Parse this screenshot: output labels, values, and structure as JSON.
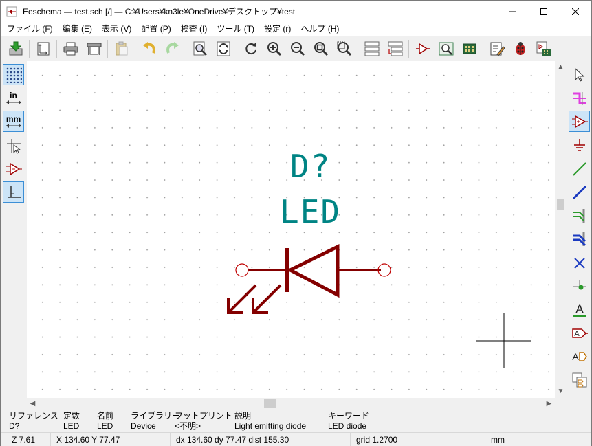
{
  "window": {
    "title": "Eeschema — test.sch [/] — C:¥Users¥kn3le¥OneDrive¥デスクトップ¥test"
  },
  "menu": [
    {
      "label": "ファイル (F)"
    },
    {
      "label": "編集 (E)"
    },
    {
      "label": "表示 (V)"
    },
    {
      "label": "配置 (P)"
    },
    {
      "label": "検査 (I)"
    },
    {
      "label": "ツール (T)"
    },
    {
      "label": "設定 (r)"
    },
    {
      "label": "ヘルプ (H)"
    }
  ],
  "left_toolbar": {
    "units_in_label": "in",
    "units_mm_label": "mm"
  },
  "schematic": {
    "reference": "D?",
    "value": "LED",
    "colors": {
      "wire_body": "#840000",
      "text": "#008484",
      "pin_end": "#c00000"
    }
  },
  "message_panel": [
    {
      "header": "リファレンス",
      "value": "D?"
    },
    {
      "header": "定数",
      "value": "LED"
    },
    {
      "header": "名前",
      "value": "LED"
    },
    {
      "header": "ライブラリー",
      "value": "Device"
    },
    {
      "header": "フットプリント",
      "value": "<不明>"
    },
    {
      "header": "説明",
      "value": "Light emitting diode"
    },
    {
      "header": "キーワード",
      "value": "LED diode"
    }
  ],
  "status_bar": {
    "zoom": "Z 7.61",
    "cursor": "X 134.60  Y 77.47",
    "delta": "dx 134.60  dy 77.47  dist 155.30",
    "grid": "grid 1.2700",
    "units": "mm"
  },
  "icons": [
    "kicad-eeschema-app-icon",
    "minimize-icon",
    "maximize-icon",
    "close-icon",
    "save-icon",
    "page-settings-icon",
    "print-icon",
    "plot-icon",
    "paste-icon",
    "undo-icon",
    "redo-icon",
    "find-icon",
    "find-replace-icon",
    "refresh-icon",
    "zoom-in-icon",
    "zoom-out-icon",
    "zoom-fit-icon",
    "zoom-selection-icon",
    "hierarchy-navigator-icon",
    "leave-sheet-icon",
    "symbol-editor-icon",
    "symbol-browser-icon",
    "assign-footprints-icon",
    "annotate-icon",
    "erc-icon",
    "netlist-icon",
    "grid-toggle-icon",
    "units-inch-icon",
    "units-mm-icon",
    "cursor-style-icon",
    "hidden-pins-icon",
    "wire-45-icon",
    "select-arrow-icon",
    "highlight-net-icon",
    "add-symbol-icon",
    "add-power-icon",
    "add-wire-icon",
    "add-bus-icon",
    "wire-bus-entry-icon",
    "bus-bus-entry-icon",
    "no-connect-icon",
    "add-junction-icon",
    "net-label-icon",
    "global-label-icon",
    "hier-label-icon",
    "hier-sheet-icon"
  ]
}
